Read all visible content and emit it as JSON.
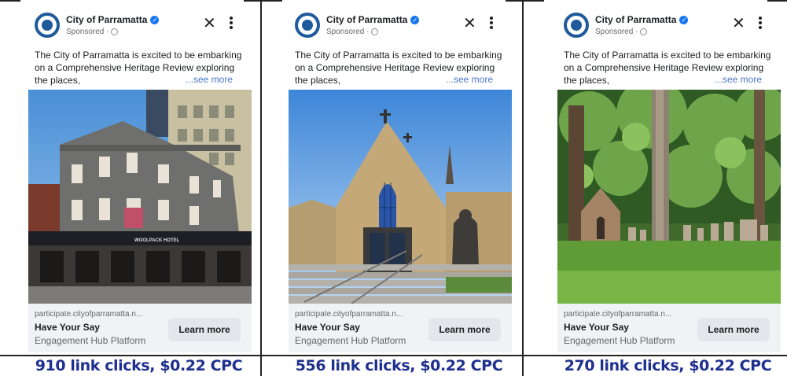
{
  "ads": [
    {
      "page_name": "City of Parramatta",
      "sponsored": "Sponsored ·",
      "body": "The City of Parramatta is excited to be embarking on a Comprehensive Heritage Review exploring the places,",
      "see_more": "...see more",
      "domain": "participate.cityofparramatta.n...",
      "headline": "Have Your Say",
      "description": "Engagement Hub Platform",
      "cta": "Learn more",
      "image_sign": "WOOLPACK HOTEL",
      "result": "910 link clicks, $0.22 CPC"
    },
    {
      "page_name": "City of Parramatta",
      "sponsored": "Sponsored ·",
      "body": "The City of Parramatta is excited to be embarking on a Comprehensive Heritage Review exploring the places,",
      "see_more": "...see more",
      "domain": "participate.cityofparramatta.n...",
      "headline": "Have Your Say",
      "description": "Engagement Hub Platform",
      "cta": "Learn more",
      "result": "556 link clicks, $0.22 CPC"
    },
    {
      "page_name": "City of Parramatta",
      "sponsored": "Sponsored ·",
      "body": "The City of Parramatta is excited to be embarking on a Comprehensive Heritage Review exploring the places,",
      "see_more": "...see more",
      "domain": "participate.cityofparramatta.n...",
      "headline": "Have Your Say",
      "description": "Engagement Hub Platform",
      "cta": "Learn more",
      "result": "270 link clicks, $0.22 CPC"
    }
  ],
  "colors": {
    "verified": "#1877f2",
    "see_more": "#4a76c9",
    "result_text": "#1e2f8f",
    "footer_bg": "#f0f2f5",
    "cta_bg": "#e4e6eb"
  },
  "icons": [
    "city-crest-icon",
    "verified-badge-icon",
    "globe-icon",
    "close-icon",
    "more-options-icon"
  ]
}
